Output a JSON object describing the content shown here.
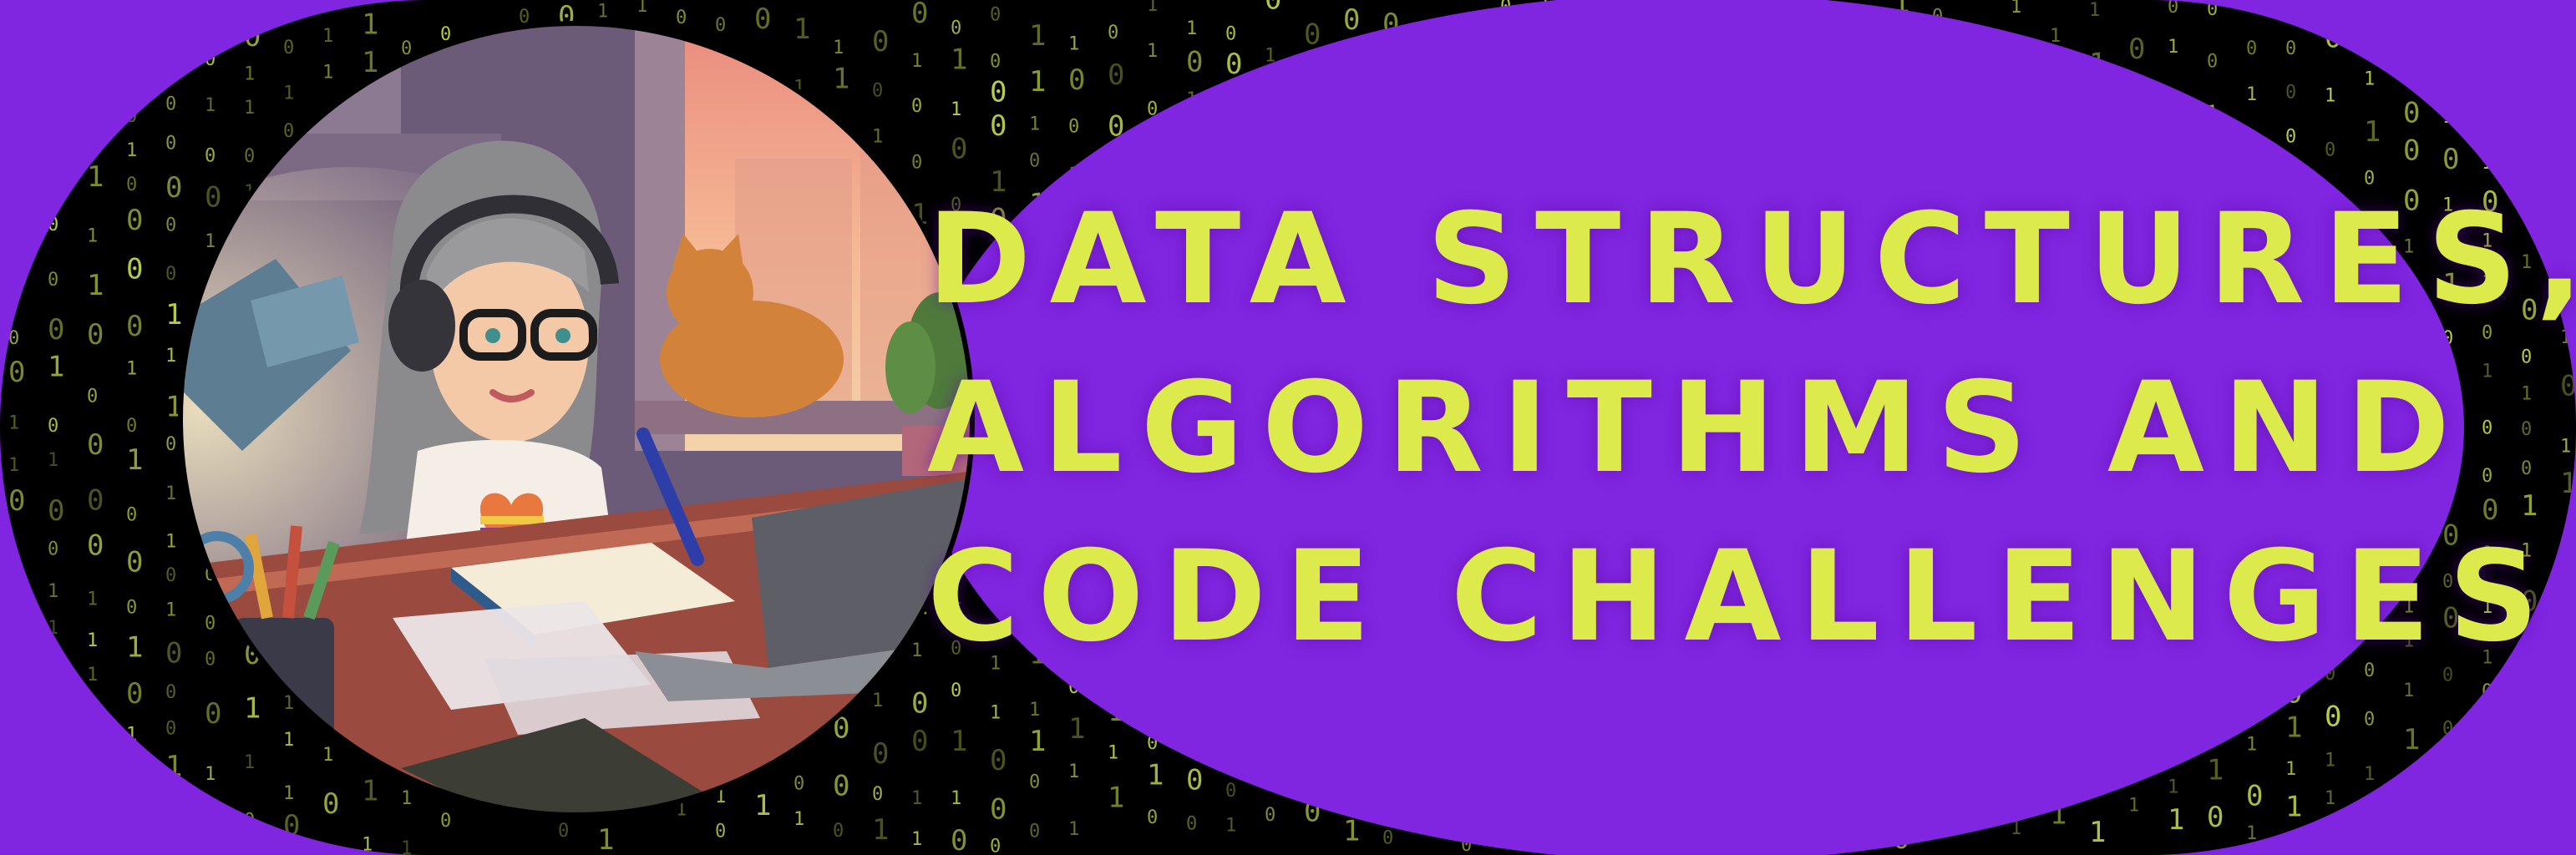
{
  "banner": {
    "title_lines": [
      "DATA STRUCTURES,",
      "ALGORITHMS AND",
      "CODE CHALLENGES"
    ]
  },
  "colors": {
    "background": "#8025e0",
    "pill": "#000000",
    "ellipse": "#8025e0",
    "title": "#dcea4b",
    "binary_digits": "#c4d94a"
  },
  "illustration": {
    "subject": "cartoon avatar with headphones and glasses writing in a notebook at a desk with a laptop, desk lamp, pencil cup, plant and a sleeping cat on the windowsill"
  }
}
